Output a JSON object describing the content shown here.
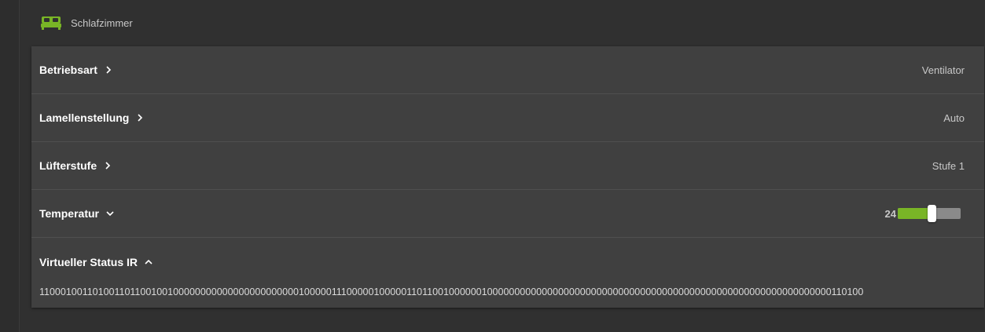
{
  "group": {
    "title": "Schlafzimmer",
    "icon": "bed-icon",
    "accent": "#79b526"
  },
  "rows": [
    {
      "label": "Betriebsart",
      "value": "Ventilator",
      "chevron": "chevron-right"
    },
    {
      "label": "Lamellenstellung",
      "value": "Auto",
      "chevron": "chevron-right"
    },
    {
      "label": "Lüfterstufe",
      "value": "Stufe 1",
      "chevron": "chevron-right"
    }
  ],
  "temperature": {
    "label": "Temperatur",
    "value": "24",
    "chevron": "chevron-down",
    "slider_fraction": 0.54
  },
  "ir_status": {
    "label": "Virtueller Status IR",
    "chevron": "chevron-up",
    "bits": "11000100110100110110010010000000000000000000000010000011100000100000110110010000001000000000000000000000000000000000000000000000000000000000000000110100"
  }
}
